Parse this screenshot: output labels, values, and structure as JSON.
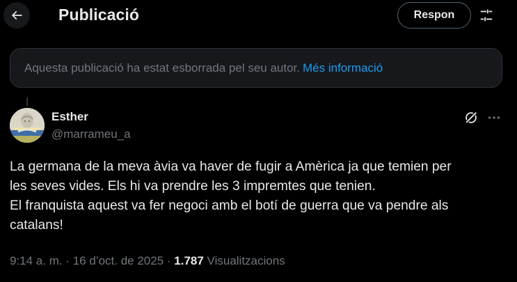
{
  "header": {
    "title": "Publicació",
    "reply_label": "Respon",
    "back_icon": "arrow-left-icon",
    "filter_icon": "sliders-icon"
  },
  "notice": {
    "text": "Aquesta publicació ha estat esborrada pel seu autor.",
    "link": "Més informació"
  },
  "post": {
    "author": {
      "name": "Esther",
      "handle": "@marrameu_a"
    },
    "lines": [
      "La germana de la meva àvia va haver de fugir a Amèrica ja que temien per",
      "les seves vides. Els hi va prendre les 3 impremtes que tenien.",
      "El franquista aquest va fer negoci amb el botí de guerra que va pendre als",
      "catalans!"
    ],
    "meta": {
      "time": "9:14 a. m.",
      "separator1": " · ",
      "date": "16 d’oct. de 2025",
      "separator2": " · ",
      "views": "1.787",
      "views_label": " Visualitzacions"
    }
  },
  "colors": {
    "background": "#000000",
    "text": "#e7e9ea",
    "secondary": "#71767b",
    "link": "#1d9bf0",
    "notice_bg": "#16181c",
    "border": "#2f3336"
  }
}
